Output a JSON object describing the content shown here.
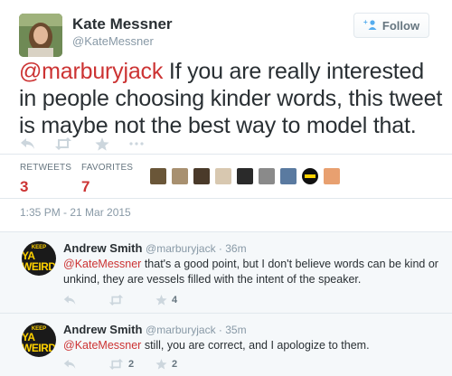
{
  "tweet": {
    "author_name": "Kate Messner",
    "author_handle": "@KateMessner",
    "follow_label": "Follow",
    "mention": "@marburyjack",
    "text": " If you are really interested in people choosing kinder words, this tweet is maybe not the best way to model that.",
    "stats": {
      "retweets_label": "RETWEETS",
      "retweets_value": "3",
      "favorites_label": "FAVORITES",
      "favorites_value": "7"
    },
    "timestamp": "1:35 PM - 21 Mar 2015"
  },
  "colors": {
    "accent": "#cc3333",
    "secondary_text": "#8899a6",
    "border": "#e1e8ed",
    "reply_bg": "#f5f8fa",
    "ya_badge": "#ffd200"
  },
  "icons": [
    "reply-icon",
    "retweet-icon",
    "favorite-star-icon",
    "more-icon",
    "follow-person-icon"
  ],
  "replies": [
    {
      "author_name": "Andrew Smith",
      "handle": "@marburyjack",
      "separator": " · ",
      "time": "36m",
      "avatar_top": "KEEP",
      "avatar_main": "YA WEIRD",
      "mention": "@KateMessner",
      "text": " that's a good point, but I don't believe words can be kind or unkind, they are vessels filled with the intent of the speaker.",
      "retweets": "",
      "favorites": "4"
    },
    {
      "author_name": "Andrew Smith",
      "handle": "@marburyjack",
      "separator": " · ",
      "time": "35m",
      "avatar_top": "KEEP",
      "avatar_main": "YA WEIRD",
      "mention": "@KateMessner",
      "text": " still, you are correct, and I apologize to them.",
      "retweets": "2",
      "favorites": "2"
    }
  ]
}
